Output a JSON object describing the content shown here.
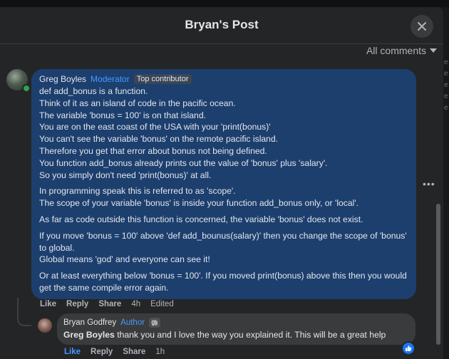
{
  "post": {
    "title": "Bryan's Post",
    "sort_label": "All comments"
  },
  "comment": {
    "author": "Greg Boyles",
    "badges": [
      "Moderator",
      "Top contributor"
    ],
    "paragraphs": [
      [
        "def add_bonus is a function.",
        "Think of it as an island of code in the pacific ocean.",
        "The variable 'bonus = 100' is on that island.",
        "You are on the east coast of the USA with your 'print(bonus)'",
        "You can't see the variable 'bonus' on the remote pacific island.",
        "Therefore you get that error about bonus not being defined.",
        "You function add_bonus already prints out the value of 'bonus' plus 'salary'.",
        "So you simply don't need 'print(bonus)' at all."
      ],
      [
        "In programming speak this is referred to as 'scope'.",
        "The scope of your variable 'bonus' is inside your function add_bonus only, or 'local'."
      ],
      [
        "As far as code outside this function is concerned, the variable 'bonus' does not exist."
      ],
      [
        "If you move 'bonus = 100' above 'def add_bounus(salary)' then you change the scope of 'bonus' to global.",
        "Global means 'god' and everyone can see it!"
      ],
      [
        "Or at least everything below 'bonus = 100'. If you moved print(bonus) above this then you would get the same compile error again."
      ]
    ],
    "actions": {
      "like": "Like",
      "reply": "Reply",
      "share": "Share",
      "time": "4h",
      "edited": "Edited"
    }
  },
  "reply": {
    "author": "Bryan Godfrey",
    "badge": "Author",
    "mention": "Greg Boyles",
    "text": " thank you and I love the way you explained it. This will be a great help",
    "actions": {
      "like": "Like",
      "reply": "Reply",
      "share": "Share",
      "time": "1h"
    }
  },
  "colors": {
    "accent": "#4599ff",
    "bubble": "#1c3f6e",
    "online": "#31a24c"
  },
  "icons": [
    "close-icon",
    "chevron-down-icon",
    "more-dots-icon",
    "wave-icon",
    "like-reaction-icon"
  ]
}
